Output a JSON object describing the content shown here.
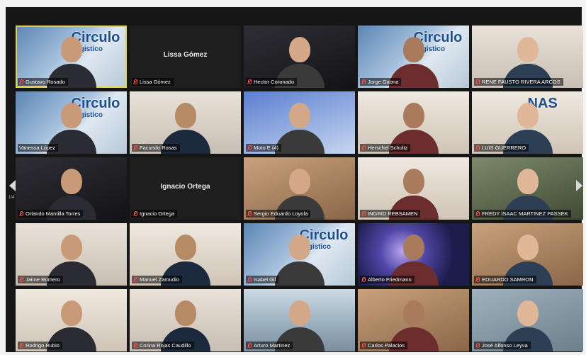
{
  "page_indicator": "1/4",
  "participants": [
    {
      "name": "Gustavo Rosado",
      "muted": true,
      "bg": "bg-logo",
      "active": true,
      "logo": "Circulo",
      "logo_sub": "Logistico"
    },
    {
      "name": "Lissa Gómez",
      "muted": true,
      "bg": "dark",
      "video_off": true
    },
    {
      "name": "Hector Coronado",
      "muted": true,
      "bg": "bg-night"
    },
    {
      "name": "Jorge Gaona",
      "muted": true,
      "bg": "bg-logo",
      "logo": "Circulo",
      "logo_sub": "Logistico"
    },
    {
      "name": "RENE FAUSTO RIVERA ARCOS",
      "muted": true,
      "bg": "bg-wall"
    },
    {
      "name": "Vanessa López",
      "muted": false,
      "bg": "bg-logo",
      "logo": "Circulo",
      "logo_sub": "Logistico"
    },
    {
      "name": "Facundo Rosas",
      "muted": true,
      "bg": "bg-wall"
    },
    {
      "name": "Moto E (4)",
      "muted": true,
      "bg": "bg-blue"
    },
    {
      "name": "Herschel Schultz",
      "muted": true,
      "bg": "bg-room"
    },
    {
      "name": "LUIS GUERRERO",
      "muted": true,
      "bg": "bg-room",
      "logo": "NAS"
    },
    {
      "name": "Orlando Mantilla Torres",
      "muted": true,
      "bg": "bg-night"
    },
    {
      "name": "Ignacio Ortega",
      "muted": true,
      "bg": "dark",
      "video_off": true
    },
    {
      "name": "Sergio Eduardo Loyola",
      "muted": true,
      "bg": "bg-warm"
    },
    {
      "name": "INGRID REBSAMEN",
      "muted": true,
      "bg": "bg-room"
    },
    {
      "name": "FREDY ISAAC MARTINEZ PASSEK",
      "muted": true,
      "bg": "bg-green"
    },
    {
      "name": "Jaime Romero",
      "muted": true,
      "bg": "bg-wall"
    },
    {
      "name": "Manuel Zamudio",
      "muted": true,
      "bg": "bg-room"
    },
    {
      "name": "Isabel Gil",
      "muted": true,
      "bg": "bg-logo",
      "logo": "Circulo",
      "logo_sub": "Logistico"
    },
    {
      "name": "Alberto Friedmann",
      "muted": true,
      "bg": "bg-space"
    },
    {
      "name": "EDUARDO SAMRON",
      "muted": true,
      "bg": "bg-warm"
    },
    {
      "name": "Rodrigo Rubio",
      "muted": true,
      "bg": "bg-room"
    },
    {
      "name": "Corina Rojas Caudillo",
      "muted": true,
      "bg": "bg-wall"
    },
    {
      "name": "Arturo Martinez",
      "muted": true,
      "bg": "bg-sea"
    },
    {
      "name": "Carlos Palacios",
      "muted": true,
      "bg": "bg-warm"
    },
    {
      "name": "José Alfonso Leyva",
      "muted": true,
      "bg": "bg-cool"
    }
  ],
  "icons": {
    "mic_muted": "mic-muted-icon",
    "prev": "arrow-left-icon",
    "next": "arrow-right-icon"
  }
}
